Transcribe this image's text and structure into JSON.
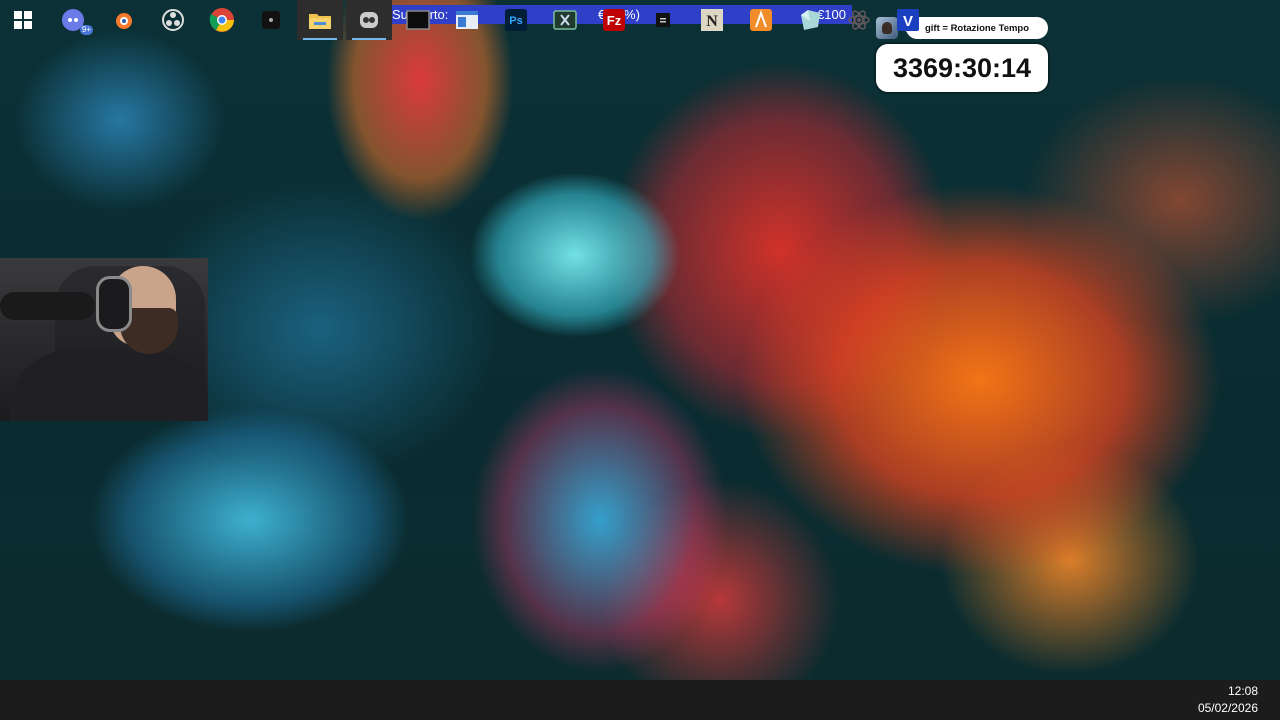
{
  "overlay": {
    "support_label": "Supporto:",
    "support_progress": "€0(0%)",
    "support_goal": "€100",
    "support_progress_fraction": 0.0,
    "support_bar_color": "#2f3fc8",
    "gift_text": "gift = Rotazione Tempo",
    "timer": "3369:30:14"
  },
  "taskbar": {
    "items": [
      {
        "name": "start-icon",
        "glyph": "⊞"
      },
      {
        "name": "discord-icon",
        "glyph": "",
        "badge": "9+"
      },
      {
        "name": "blender-icon",
        "glyph": ""
      },
      {
        "name": "obs-icon",
        "glyph": ""
      },
      {
        "name": "chrome-icon",
        "glyph": ""
      },
      {
        "name": "app-icon",
        "glyph": ""
      },
      {
        "name": "file-explorer-icon",
        "glyph": ""
      },
      {
        "name": "mascot-app-icon",
        "glyph": ""
      },
      {
        "name": "terminal-icon",
        "glyph": ""
      },
      {
        "name": "window-app-icon",
        "glyph": ""
      },
      {
        "name": "photoshop-icon",
        "glyph": "Ps"
      },
      {
        "name": "excel-app-icon",
        "glyph": ""
      },
      {
        "name": "filezilla-icon",
        "glyph": "Fz"
      },
      {
        "name": "small-app-icon",
        "glyph": ""
      },
      {
        "name": "notepad-app-icon",
        "glyph": "N"
      },
      {
        "name": "sublime-app-icon",
        "glyph": ""
      },
      {
        "name": "gem-app-icon",
        "glyph": ""
      },
      {
        "name": "atom-icon",
        "glyph": ""
      },
      {
        "name": "v-app-icon",
        "glyph": "V"
      }
    ],
    "clock_time": "12:08",
    "clock_date": "05/02/2026"
  }
}
